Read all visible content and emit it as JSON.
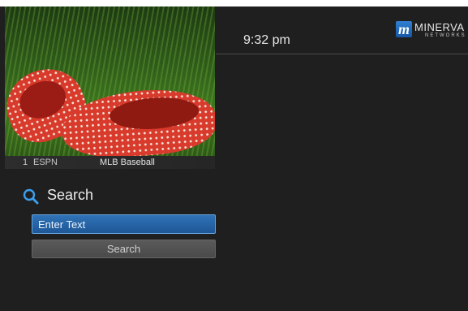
{
  "header": {
    "title_fragment": "",
    "time": "9:32 pm"
  },
  "brand": {
    "logo_mark": "m",
    "logo_word": "MINERVA",
    "logo_sub": "NETWORKS"
  },
  "now_playing": {
    "channel_number": "1",
    "network": "ESPN",
    "program": "MLB Baseball"
  },
  "search": {
    "title": "Search",
    "input_placeholder": "Enter Text",
    "button_label": "Search"
  },
  "colors": {
    "accent_blue": "#2f73b6",
    "background": "#1f1f1f"
  }
}
